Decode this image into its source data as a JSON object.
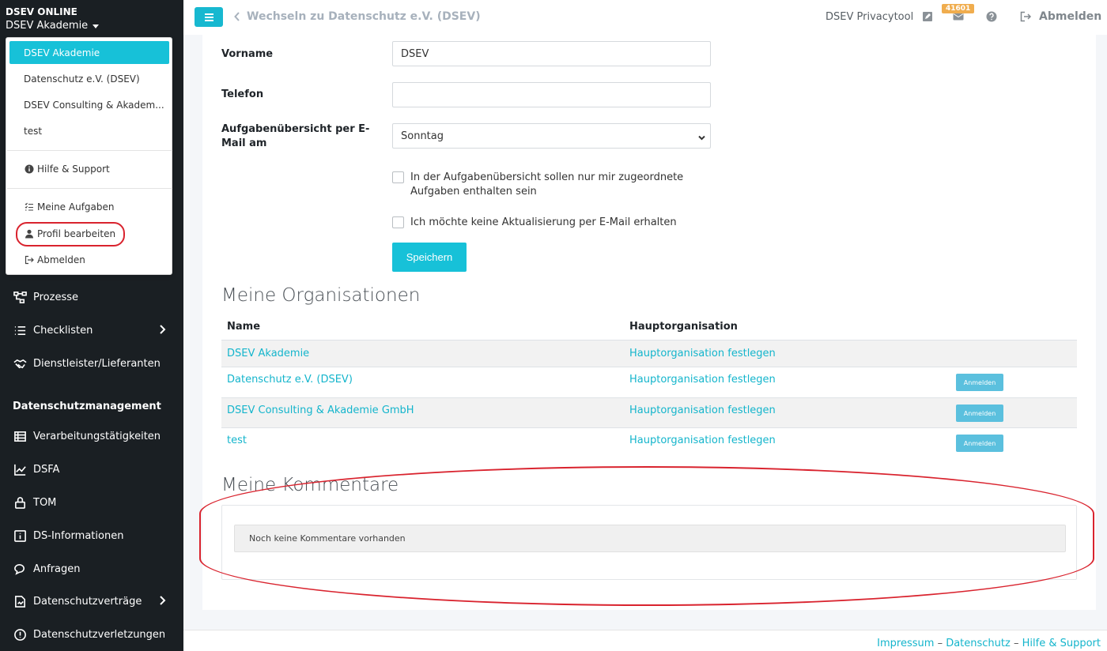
{
  "sidebar": {
    "brand": "DSEV ONLINE",
    "org_selected": "DSEV Akademie",
    "nav": [
      {
        "label": "Prozesse",
        "icon": "sitemap-icon",
        "chevron": false
      },
      {
        "label": "Checklisten",
        "icon": "list-icon",
        "chevron": true
      },
      {
        "label": "Dienstleister/Lieferanten",
        "icon": "handshake-icon",
        "chevron": false
      }
    ],
    "section_title": "Datenschutzmanagement",
    "nav2": [
      {
        "label": "Verarbeitungstätigkeiten",
        "icon": "table-list-icon",
        "chevron": false
      },
      {
        "label": "DSFA",
        "icon": "chart-line-icon",
        "chevron": false
      },
      {
        "label": "TOM",
        "icon": "lock-icon",
        "chevron": false
      },
      {
        "label": "DS-Informationen",
        "icon": "info-square-icon",
        "chevron": false
      },
      {
        "label": "Anfragen",
        "icon": "comments-icon",
        "chevron": false
      },
      {
        "label": "Datenschutzverträge",
        "icon": "file-signature-icon",
        "chevron": true
      },
      {
        "label": "Datenschutzverletzungen",
        "icon": "exclamation-circle-icon",
        "chevron": false
      }
    ]
  },
  "dropdown": {
    "orgs": [
      "DSEV Akademie",
      "Datenschutz e.V. (DSEV)",
      "DSEV Consulting & Akadem...",
      "test"
    ],
    "help": "Hilfe & Support",
    "tasks": "Meine Aufgaben",
    "profile": "Profil bearbeiten",
    "logout": "Abmelden"
  },
  "topbar": {
    "switch_label": "Wechseln zu Datenschutz e.V. (DSEV)",
    "tool_name": "DSEV Privacytool",
    "badge_count": "41601",
    "logout": "Abmelden"
  },
  "form": {
    "vorname_label": "Vorname",
    "vorname_value": "DSEV",
    "telefon_label": "Telefon",
    "telefon_value": "",
    "aufgaben_label": "Aufgabenübersicht per E-Mail am",
    "aufgaben_value": "Sonntag",
    "checkbox1": "In der Aufgabenübersicht sollen nur mir zugeordnete Aufgaben enthalten sein",
    "checkbox2": "Ich möchte keine Aktualisierung per E-Mail erhalten",
    "save": "Speichern"
  },
  "orgs_section": {
    "title": "Meine Organisationen",
    "col_name": "Name",
    "col_main": "Hauptorganisation",
    "rows": [
      {
        "name": "DSEV Akademie",
        "main": "Hauptorganisation festlegen",
        "action": ""
      },
      {
        "name": "Datenschutz e.V. (DSEV)",
        "main": "Hauptorganisation festlegen",
        "action": "Anmelden"
      },
      {
        "name": "DSEV Consulting & Akademie GmbH",
        "main": "Hauptorganisation festlegen",
        "action": "Anmelden"
      },
      {
        "name": "test",
        "main": "Hauptorganisation festlegen",
        "action": "Anmelden"
      }
    ]
  },
  "comments_section": {
    "title": "Meine Kommentare",
    "empty": "Noch keine Kommentare vorhanden"
  },
  "footer": {
    "impressum": "Impressum",
    "sep": "–",
    "datenschutz": "Datenschutz",
    "hilfe": "Hilfe & Support"
  },
  "colors": {
    "accent": "#17c1d8",
    "sidebar_bg": "#1a1f23",
    "highlight_red": "#d9232e",
    "badge": "#f0ad4e"
  }
}
